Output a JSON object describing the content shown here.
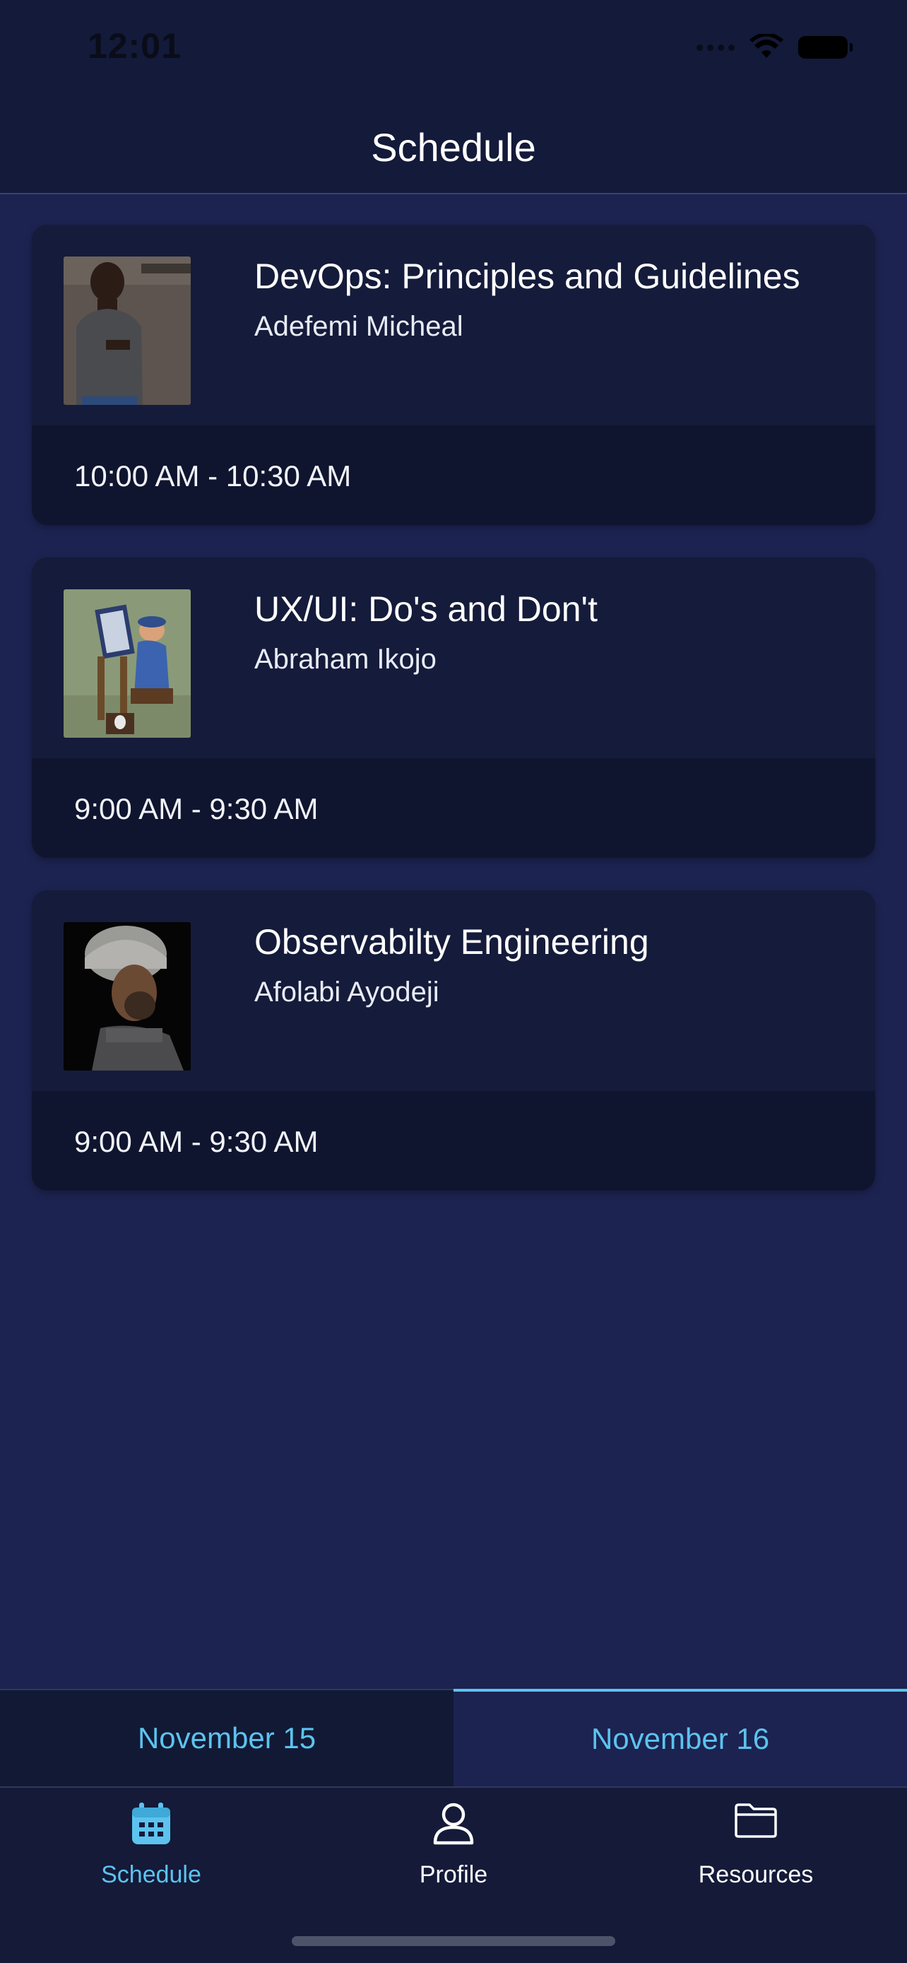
{
  "status_bar": {
    "time": "12:01"
  },
  "header": {
    "title": "Schedule"
  },
  "sessions": [
    {
      "title": "DevOps: Principles and Guidelines",
      "speaker": "Adefemi Micheal",
      "time": "10:00 AM - 10:30 AM"
    },
    {
      "title": "UX/UI: Do's and Don't",
      "speaker": "Abraham Ikojo",
      "time": "9:00 AM - 9:30 AM"
    },
    {
      "title": "Observabilty Engineering",
      "speaker": "Afolabi Ayodeji",
      "time": "9:00 AM - 9:30 AM"
    }
  ],
  "day_tabs": [
    {
      "label": "November 15",
      "selected": false
    },
    {
      "label": "November 16",
      "selected": true
    }
  ],
  "tab_bar": [
    {
      "label": "Schedule",
      "icon": "calendar-icon",
      "selected": true
    },
    {
      "label": "Profile",
      "icon": "person-icon",
      "selected": false
    },
    {
      "label": "Resources",
      "icon": "folder-icon",
      "selected": false
    }
  ],
  "colors": {
    "accent": "#5cc3ef",
    "background": "#1c2350",
    "card": "#151b3a",
    "bar": "#141a38"
  }
}
